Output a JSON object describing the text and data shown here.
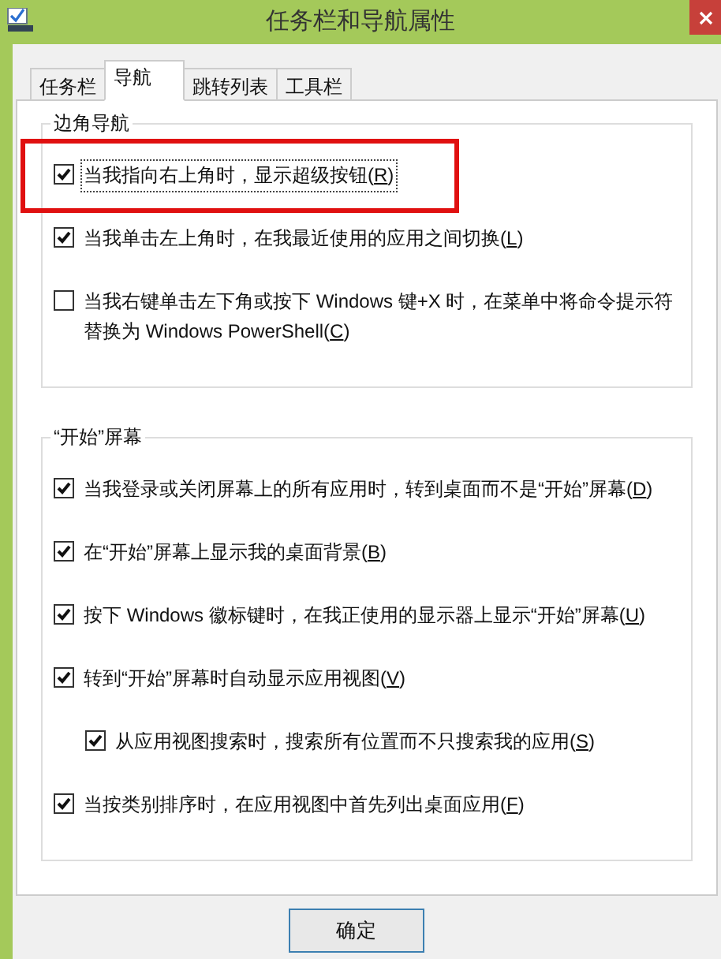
{
  "window": {
    "title": "任务栏和导航属性"
  },
  "tabs": [
    {
      "label": "任务栏",
      "selected": false
    },
    {
      "label": "导航",
      "selected": true
    },
    {
      "label": "跳转列表",
      "selected": false
    },
    {
      "label": "工具栏",
      "selected": false
    }
  ],
  "groups": [
    {
      "title": "边角导航",
      "items": [
        {
          "label": "当我指向右上角时，显示超级按钮(R)",
          "checked": true,
          "highlighted": true,
          "focused": true
        },
        {
          "label": "当我单击左上角时，在我最近使用的应用之间切换(L)",
          "checked": true,
          "highlighted": false,
          "focused": false
        },
        {
          "label": "当我右键单击左下角或按下 Windows 键+X 时，在菜单中将命令提示符替换为 Windows PowerShell(C)",
          "checked": false,
          "highlighted": false,
          "focused": false
        }
      ]
    },
    {
      "title": "“开始”屏幕",
      "items": [
        {
          "label": "当我登录或关闭屏幕上的所有应用时，转到桌面而不是“开始”屏幕(D)",
          "checked": true,
          "highlighted": false,
          "focused": false
        },
        {
          "label": "在“开始”屏幕上显示我的桌面背景(B)",
          "checked": true,
          "highlighted": false,
          "focused": false
        },
        {
          "label": "按下 Windows 徽标键时，在我正使用的显示器上显示“开始”屏幕(U)",
          "checked": true,
          "highlighted": false,
          "focused": false
        },
        {
          "label": "转到“开始”屏幕时自动显示应用视图(V)",
          "checked": true,
          "highlighted": false,
          "focused": false,
          "children": [
            {
              "label": "从应用视图搜索时，搜索所有位置而不只搜索我的应用(S)",
              "checked": true,
              "highlighted": false,
              "focused": false
            }
          ]
        },
        {
          "label": "当按类别排序时，在应用视图中首先列出桌面应用(F)",
          "checked": true,
          "highlighted": false,
          "focused": false
        }
      ]
    }
  ],
  "buttons": [
    {
      "label": "确定"
    }
  ]
}
